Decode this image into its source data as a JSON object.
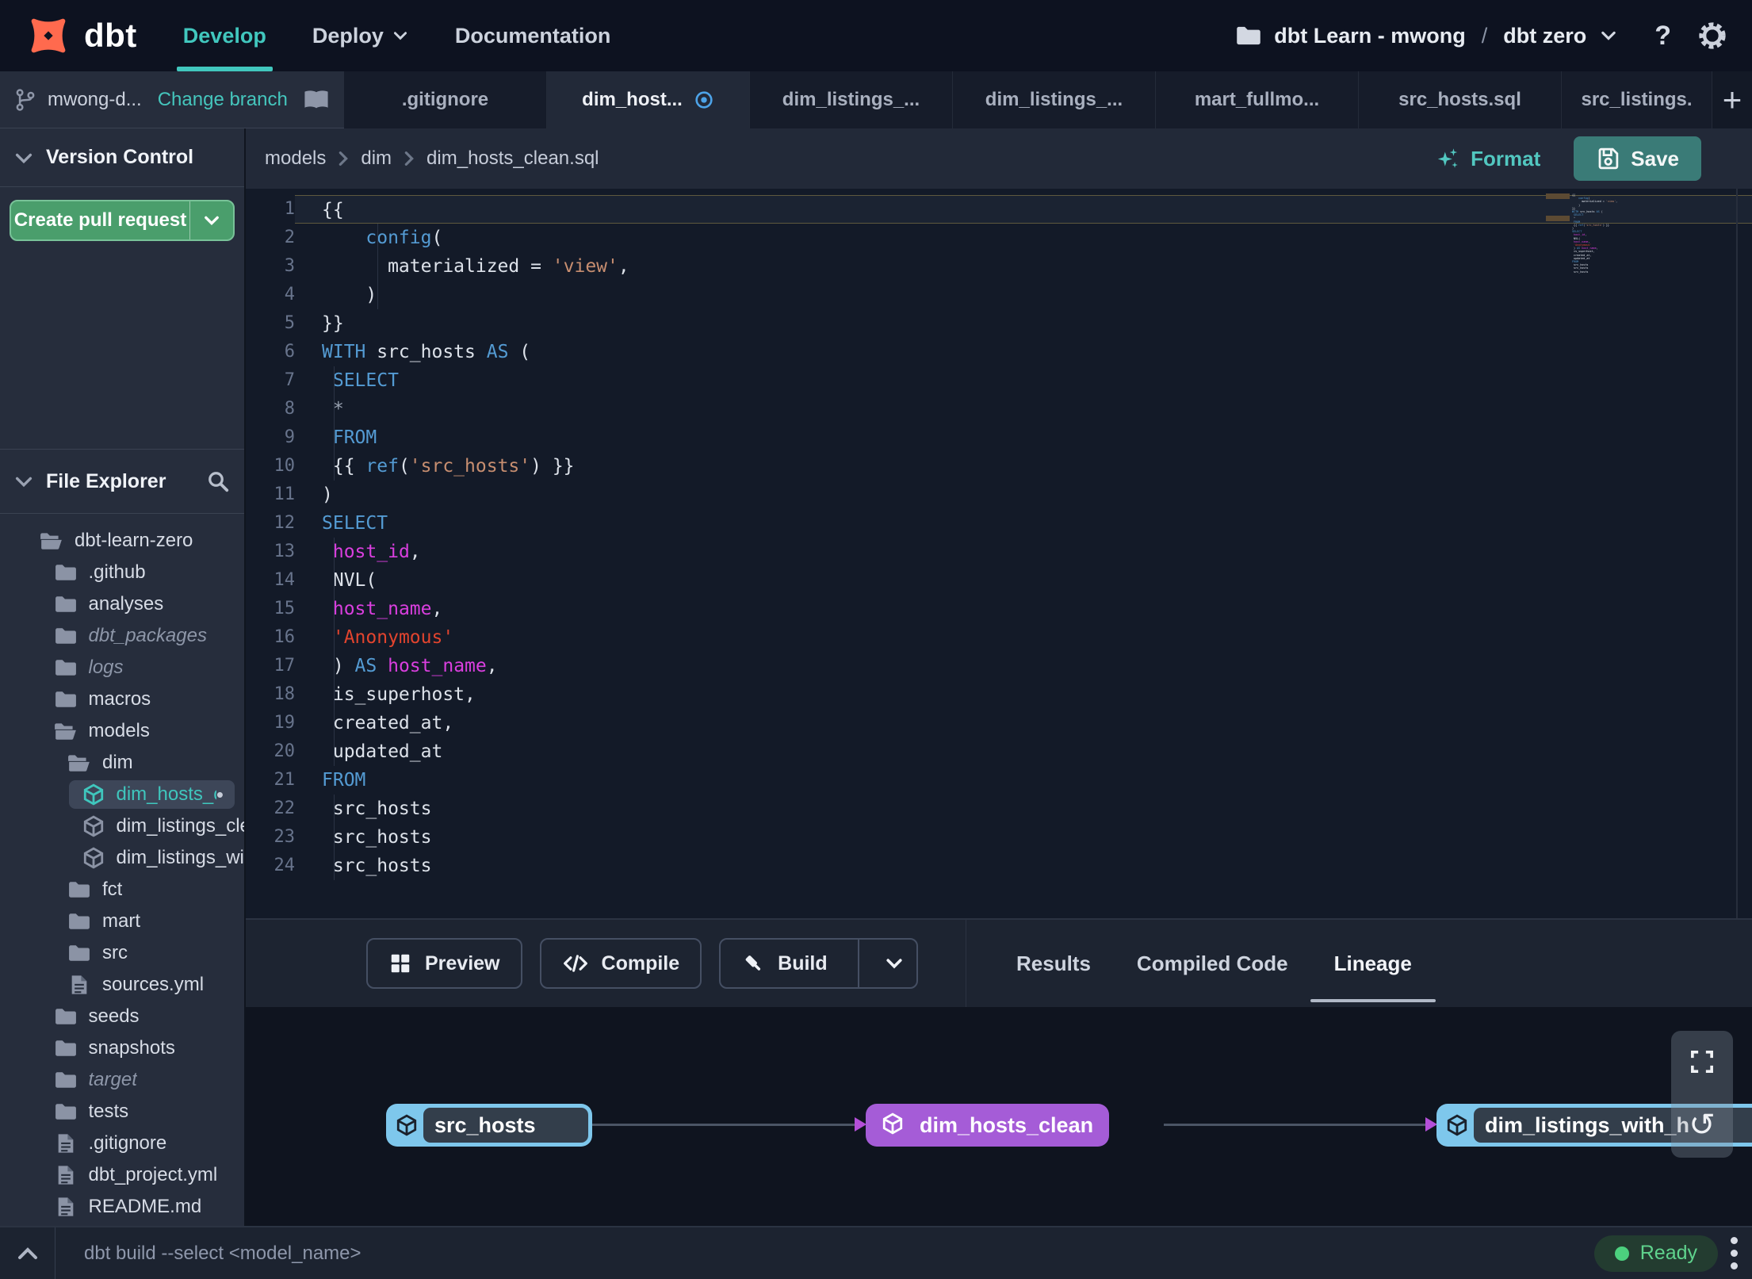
{
  "colors": {
    "accent_teal": "#41c7be",
    "brand_orange": "#ff6a4e",
    "button_green": "#4a9e6c",
    "save_teal": "#3a7b77",
    "node_blue": "#7ec7ec",
    "node_purple": "#a55cd7",
    "status_green": "#5fd38d"
  },
  "navbar": {
    "brand": "dbt",
    "items": [
      {
        "label": "Develop",
        "active": true
      },
      {
        "label": "Deploy",
        "chevron": true
      },
      {
        "label": "Documentation"
      }
    ],
    "project": {
      "account": "dbt Learn - mwong",
      "separator": "/",
      "name": "dbt zero"
    },
    "help": "?"
  },
  "sidebar": {
    "branch": {
      "name": "mwong-d...",
      "action": "Change branch"
    },
    "version_control": {
      "title": "Version Control",
      "button_label": "Create pull request"
    },
    "file_explorer": {
      "title": "File Explorer",
      "modified_dot": "•",
      "tree": [
        {
          "name": "dbt-learn-zero",
          "type": "folder-open",
          "depth": 0
        },
        {
          "name": ".github",
          "type": "folder",
          "depth": 1
        },
        {
          "name": "analyses",
          "type": "folder",
          "depth": 1
        },
        {
          "name": "dbt_packages",
          "type": "folder",
          "depth": 1,
          "italic": true
        },
        {
          "name": "logs",
          "type": "folder",
          "depth": 1,
          "italic": true
        },
        {
          "name": "macros",
          "type": "folder",
          "depth": 1
        },
        {
          "name": "models",
          "type": "folder-open",
          "depth": 1
        },
        {
          "name": "dim",
          "type": "folder-open",
          "depth": 2
        },
        {
          "name": "dim_hosts_clean.sql",
          "type": "model",
          "depth": 3,
          "selected": true,
          "modified": true
        },
        {
          "name": "dim_listings_clean.sql",
          "type": "model",
          "depth": 3
        },
        {
          "name": "dim_listings_with_hosts...",
          "type": "model",
          "depth": 3
        },
        {
          "name": "fct",
          "type": "folder",
          "depth": 2
        },
        {
          "name": "mart",
          "type": "folder",
          "depth": 2
        },
        {
          "name": "src",
          "type": "folder",
          "depth": 2
        },
        {
          "name": "sources.yml",
          "type": "file",
          "depth": 2
        },
        {
          "name": "seeds",
          "type": "folder",
          "depth": 1
        },
        {
          "name": "snapshots",
          "type": "folder",
          "depth": 1
        },
        {
          "name": "target",
          "type": "folder",
          "depth": 1,
          "italic": true
        },
        {
          "name": "tests",
          "type": "folder",
          "depth": 1
        },
        {
          "name": ".gitignore",
          "type": "file",
          "depth": 1
        },
        {
          "name": "dbt_project.yml",
          "type": "file",
          "depth": 1
        },
        {
          "name": "README.md",
          "type": "file",
          "depth": 1
        }
      ]
    }
  },
  "tabs": {
    "add_button": "+",
    "items": [
      {
        "label": ".gitignore"
      },
      {
        "label": "dim_host...",
        "active": true,
        "indicator": true
      },
      {
        "label": "dim_listings_..."
      },
      {
        "label": "dim_listings_..."
      },
      {
        "label": "mart_fullmo..."
      },
      {
        "label": "src_hosts.sql"
      },
      {
        "label": "src_listings.",
        "last": true
      }
    ]
  },
  "editor": {
    "breadcrumb": [
      "models",
      "dim",
      "dim_hosts_clean.sql"
    ],
    "format_label": "Format",
    "save_label": "Save",
    "lines": [
      {
        "n": 1,
        "cur": true,
        "t": [
          [
            "d",
            "{{"
          ]
        ]
      },
      {
        "n": 2,
        "t": [
          [
            "d",
            "    "
          ],
          [
            "k",
            "config"
          ],
          [
            "d",
            "("
          ]
        ]
      },
      {
        "n": 3,
        "t": [
          [
            "d",
            "      materialized = "
          ],
          [
            "s",
            "'view'"
          ],
          [
            "d",
            ","
          ]
        ]
      },
      {
        "n": 4,
        "t": [
          [
            "d",
            "    )"
          ]
        ]
      },
      {
        "n": 5,
        "t": [
          [
            "d",
            "}}"
          ]
        ]
      },
      {
        "n": 6,
        "t": [
          [
            "k",
            "WITH"
          ],
          [
            "d",
            " src_hosts "
          ],
          [
            "k",
            "AS"
          ],
          [
            "d",
            " ("
          ]
        ]
      },
      {
        "n": 7,
        "t": [
          [
            "d",
            " "
          ],
          [
            "k",
            "SELECT"
          ]
        ]
      },
      {
        "n": 8,
        "t": [
          [
            "g",
            " *"
          ]
        ]
      },
      {
        "n": 9,
        "t": [
          [
            "d",
            " "
          ],
          [
            "k",
            "FROM"
          ]
        ]
      },
      {
        "n": 10,
        "t": [
          [
            "d",
            " {{ "
          ],
          [
            "k",
            "ref"
          ],
          [
            "d",
            "("
          ],
          [
            "s",
            "'src_hosts'"
          ],
          [
            "d",
            ") }}"
          ]
        ]
      },
      {
        "n": 11,
        "t": [
          [
            "d",
            ")"
          ]
        ]
      },
      {
        "n": 12,
        "t": [
          [
            "k",
            "SELECT"
          ]
        ]
      },
      {
        "n": 13,
        "t": [
          [
            "d",
            " "
          ],
          [
            "m",
            "host_id"
          ],
          [
            "d",
            ","
          ]
        ]
      },
      {
        "n": 14,
        "t": [
          [
            "d",
            " NVL("
          ]
        ]
      },
      {
        "n": 15,
        "t": [
          [
            "d",
            " "
          ],
          [
            "m",
            "host_name"
          ],
          [
            "d",
            ","
          ]
        ]
      },
      {
        "n": 16,
        "t": [
          [
            "d",
            " "
          ],
          [
            "r",
            "'Anonymous'"
          ]
        ]
      },
      {
        "n": 17,
        "t": [
          [
            "d",
            " ) "
          ],
          [
            "k",
            "AS"
          ],
          [
            "d",
            " "
          ],
          [
            "m",
            "host_name"
          ],
          [
            "d",
            ","
          ]
        ]
      },
      {
        "n": 18,
        "t": [
          [
            "d",
            " is_superhost,"
          ]
        ]
      },
      {
        "n": 19,
        "t": [
          [
            "d",
            " created_at,"
          ]
        ]
      },
      {
        "n": 20,
        "t": [
          [
            "d",
            " updated_at"
          ]
        ]
      },
      {
        "n": 21,
        "t": [
          [
            "k",
            "FROM"
          ]
        ]
      },
      {
        "n": 22,
        "t": [
          [
            "d",
            " src_hosts"
          ]
        ]
      },
      {
        "n": 23,
        "t": [
          [
            "d",
            " src_hosts"
          ]
        ]
      },
      {
        "n": 24,
        "t": [
          [
            "d",
            " src_hosts"
          ]
        ]
      }
    ]
  },
  "panel": {
    "buttons": [
      {
        "label": "Preview",
        "icon": "grid"
      },
      {
        "label": "Compile",
        "icon": "code"
      },
      {
        "label": "Build",
        "icon": "hammer",
        "split": true
      }
    ],
    "tabs": [
      {
        "label": "Results"
      },
      {
        "label": "Compiled Code"
      },
      {
        "label": "Lineage",
        "active": true
      }
    ]
  },
  "lineage": {
    "nodes": [
      {
        "label": "src_hosts",
        "variant": "blue"
      },
      {
        "label": "dim_hosts_clean",
        "variant": "purple"
      },
      {
        "label": "dim_listings_with_h",
        "variant": "blue"
      }
    ]
  },
  "statusbar": {
    "command": "dbt build --select <model_name>",
    "status_label": "Ready"
  }
}
